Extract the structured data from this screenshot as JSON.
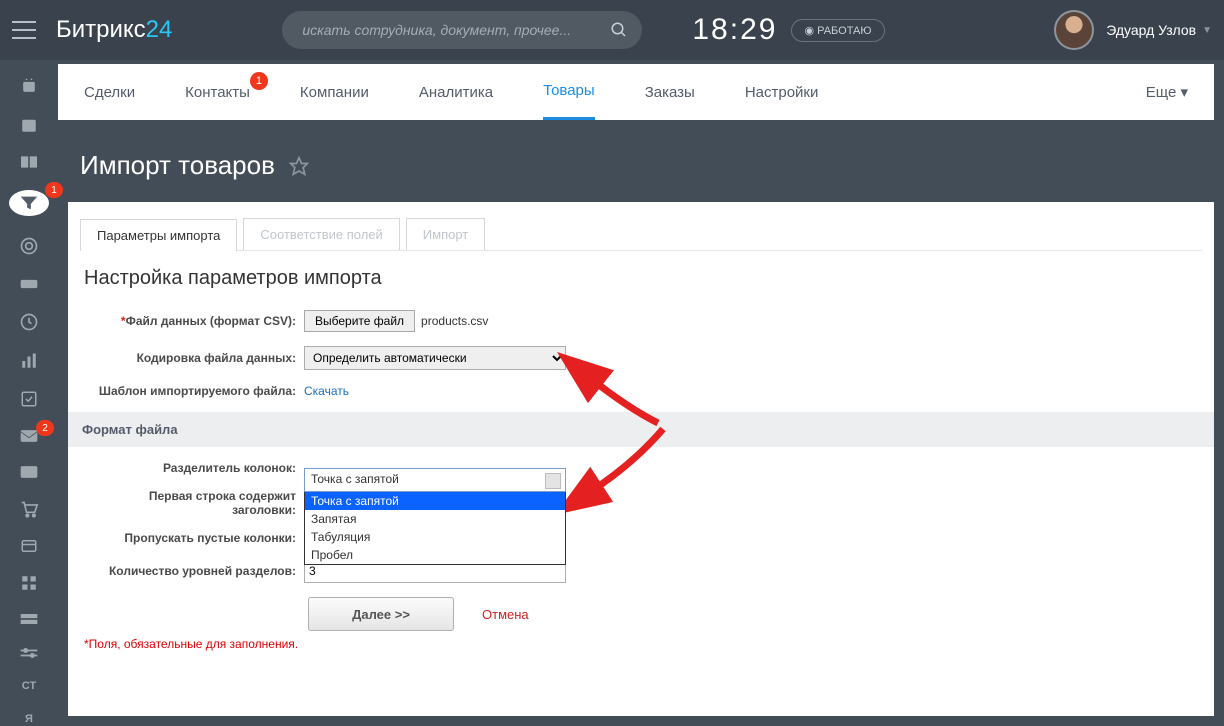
{
  "header": {
    "logo_main": "Битрикс",
    "logo_sub": "24",
    "search_placeholder": "искать сотрудника, документ, прочее...",
    "time": "18:29",
    "status": "РАБОТАЮ",
    "username": "Эдуард Узлов"
  },
  "nav": {
    "items": [
      "Сделки",
      "Контакты",
      "Компании",
      "Аналитика",
      "Товары",
      "Заказы",
      "Настройки"
    ],
    "active": "Товары",
    "badge_item": "Контакты",
    "badge_value": "1",
    "more": "Еще"
  },
  "page_title": "Импорт товаров",
  "step_tabs": [
    "Параметры импорта",
    "Соответствие полей",
    "Импорт"
  ],
  "step_active": 0,
  "section_title": "Настройка параметров импорта",
  "form": {
    "file_label": "Файл данных (формат CSV):",
    "choose_file_btn": "Выберите файл",
    "file_name": "products.csv",
    "encoding_label": "Кодировка файла данных:",
    "encoding_value": "Определить автоматически",
    "template_label": "Шаблон импортируемого файла:",
    "download": "Скачать",
    "format_section": "Формат файла",
    "delimiter_label": "Разделитель колонок:",
    "delimiter_value": "Точка с запятой",
    "delimiter_options": [
      "Точка с запятой",
      "Запятая",
      "Табуляция",
      "Пробел"
    ],
    "firstrow_label": "Первая строка содержит заголовки:",
    "skipempty_label": "Пропускать пустые колонки:",
    "levels_label": "Количество уровней разделов:",
    "levels_value": "3"
  },
  "buttons": {
    "next": "Далее >>",
    "cancel": "Отмена"
  },
  "footnote": "Поля, обязательные для заполнения.",
  "rail_text": [
    "СТ",
    "Я"
  ],
  "rail_badges": {
    "cart": "1",
    "mail": "2"
  }
}
